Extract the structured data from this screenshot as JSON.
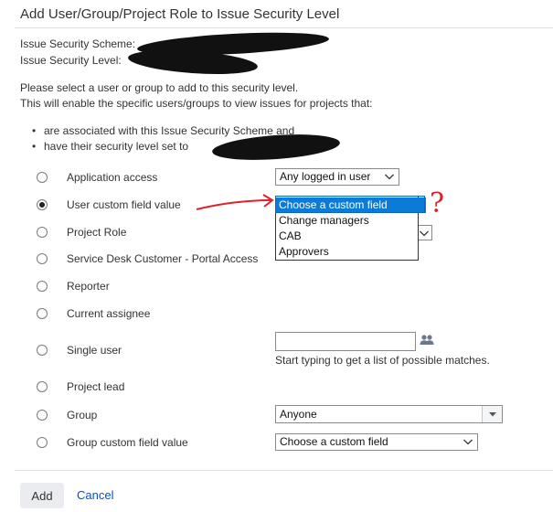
{
  "dialog": {
    "title": "Add User/Group/Project Role to Issue Security Level"
  },
  "meta": {
    "scheme_label": "Issue Security Scheme:",
    "level_label": "Issue Security Level:"
  },
  "description": {
    "line1": "Please select a user or group to add to this security level.",
    "line2": "This will enable the specific users/groups to view issues for projects that:",
    "bullet1": "are associated with this Issue Security Scheme and",
    "bullet2": "have their security level set to"
  },
  "options": [
    {
      "label": "Application access",
      "checked": false
    },
    {
      "label": "User custom field value",
      "checked": true
    },
    {
      "label": "Project Role",
      "checked": false
    },
    {
      "label": "Service Desk Customer - Portal Access",
      "checked": false
    },
    {
      "label": "Reporter",
      "checked": false
    },
    {
      "label": "Current assignee",
      "checked": false
    },
    {
      "label": "Single user",
      "checked": false
    },
    {
      "label": "Project lead",
      "checked": false
    },
    {
      "label": "Group",
      "checked": false
    },
    {
      "label": "Group custom field value",
      "checked": false
    }
  ],
  "application_access_select": {
    "value": "Any logged in user"
  },
  "user_custom_field_dropdown": {
    "options": [
      "Choose a custom field",
      "Change managers",
      "CAB",
      "Approvers"
    ],
    "selected_index": 0
  },
  "single_user": {
    "value": "",
    "hint": "Start typing to get a list of possible matches."
  },
  "group_select": {
    "value": "Anyone"
  },
  "group_custom_field_select": {
    "value": "Choose a custom field"
  },
  "footer": {
    "add_label": "Add",
    "cancel_label": "Cancel"
  },
  "annotation": {
    "mark": "?",
    "color": "#e0202a"
  },
  "icons": {
    "chevron": "chevron-down-icon",
    "users": "users-icon",
    "combo_arrow": "triangle-down-icon"
  }
}
